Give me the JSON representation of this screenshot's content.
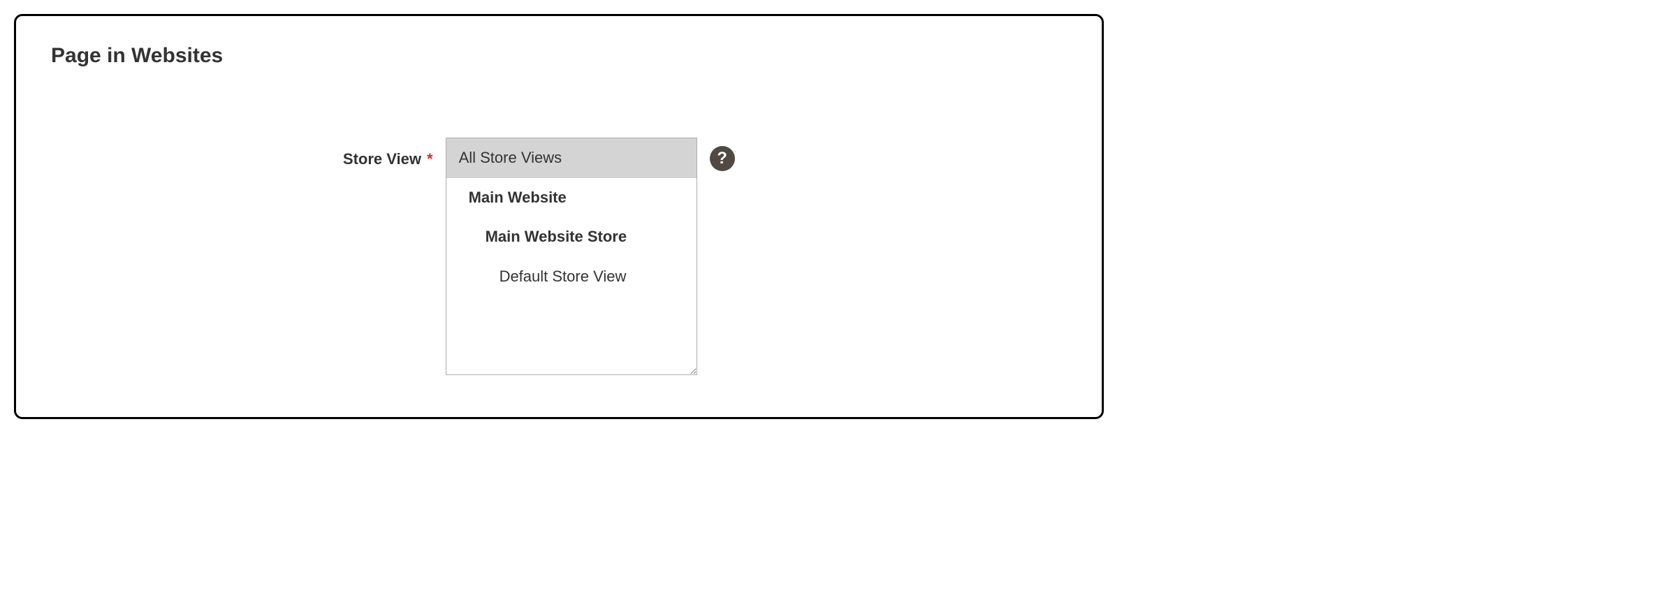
{
  "section": {
    "title": "Page in Websites"
  },
  "storeView": {
    "label": "Store View",
    "required": "*",
    "options": [
      {
        "label": "All Store Views",
        "level": 0,
        "selected": true
      },
      {
        "label": "Main Website",
        "level": 1,
        "selected": false
      },
      {
        "label": "Main Website Store",
        "level": 2,
        "selected": false
      },
      {
        "label": "Default Store View",
        "level": 3,
        "selected": false
      }
    ]
  },
  "helpIcon": {
    "glyph": "?"
  }
}
